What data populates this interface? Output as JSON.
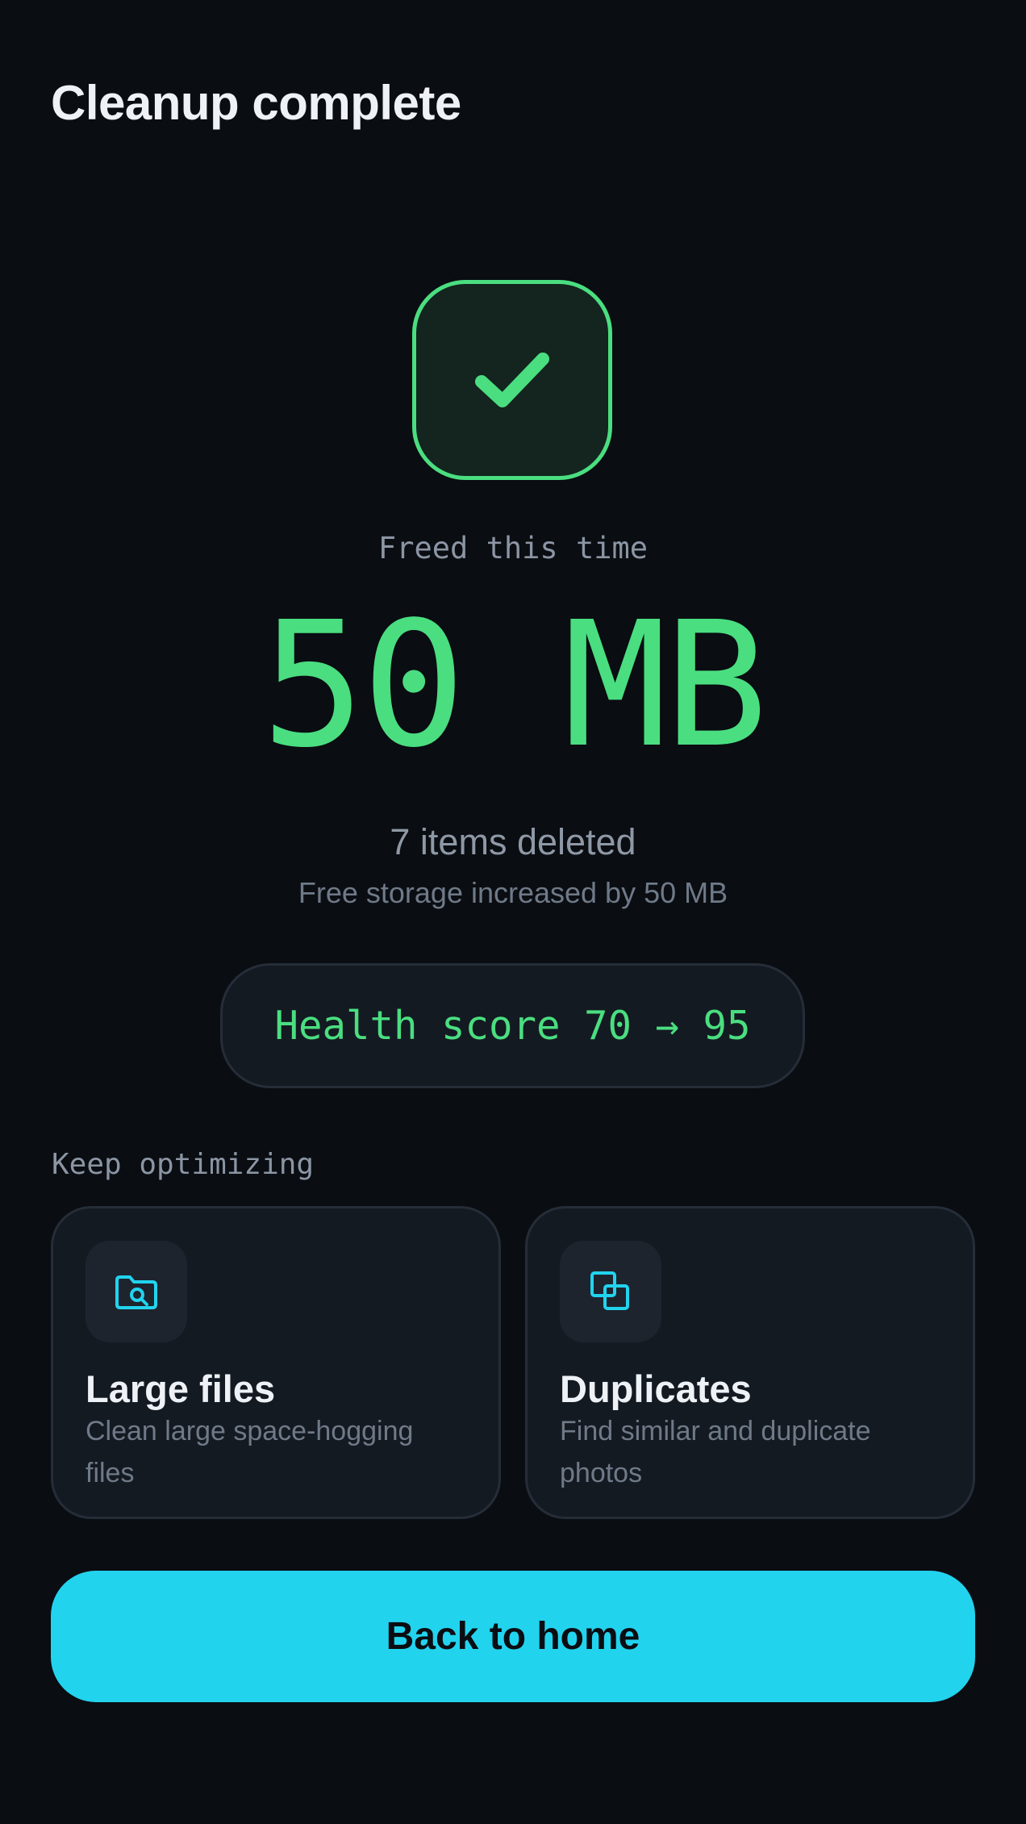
{
  "header": {
    "title": "Cleanup complete"
  },
  "result": {
    "icon": "check-icon",
    "freed_label": "Freed this time",
    "freed_amount": "50 MB",
    "items_deleted": "7 items deleted",
    "storage_note": "Free storage increased by 50 MB",
    "health_score": "Health score 70 → 95"
  },
  "suggestions": {
    "section_label": "Keep optimizing",
    "cards": [
      {
        "icon": "folder-search-icon",
        "title": "Large files",
        "description": "Clean large space-hogging files"
      },
      {
        "icon": "duplicate-icon",
        "title": "Duplicates",
        "description": "Find similar and duplicate photos"
      }
    ]
  },
  "actions": {
    "home_label": "Back to home"
  },
  "colors": {
    "background": "#0a0d12",
    "success": "#4ade80",
    "accent": "#22d3ee",
    "card": "#141a22"
  }
}
